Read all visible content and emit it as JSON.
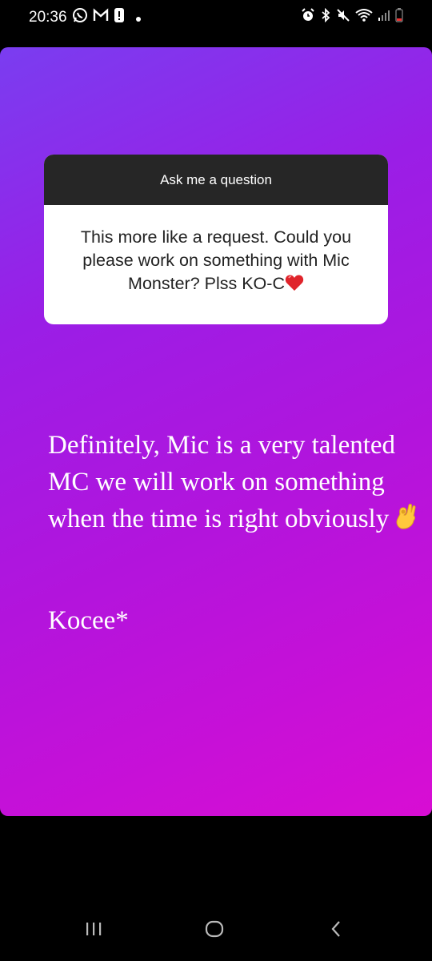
{
  "status_bar": {
    "time": "20:36",
    "icons_left": [
      "whatsapp-icon",
      "gmail-icon",
      "alert-icon",
      "dot-icon"
    ],
    "icons_right": [
      "alarm-icon",
      "bluetooth-icon",
      "mute-icon",
      "wifi-icon",
      "signal-icon",
      "battery-low-icon"
    ]
  },
  "story": {
    "gradient_colors": [
      "#7a3df0",
      "#9a1ee6",
      "#b314dc",
      "#d80dd3"
    ],
    "question_sticker": {
      "header": "Ask me a question",
      "question_text": "This more like a request.  Could you please work on something with Mic Monster? Plss KO-C",
      "question_emoji": "red-heart-icon"
    },
    "answer_text": "Definitely, Mic is a very talented MC we will work on something when the time is right obviously",
    "answer_emoji": "ok-hand-icon",
    "signature": "Kocee*"
  },
  "nav_bar": {
    "buttons": [
      "recent-apps-icon",
      "home-icon",
      "back-icon"
    ]
  }
}
